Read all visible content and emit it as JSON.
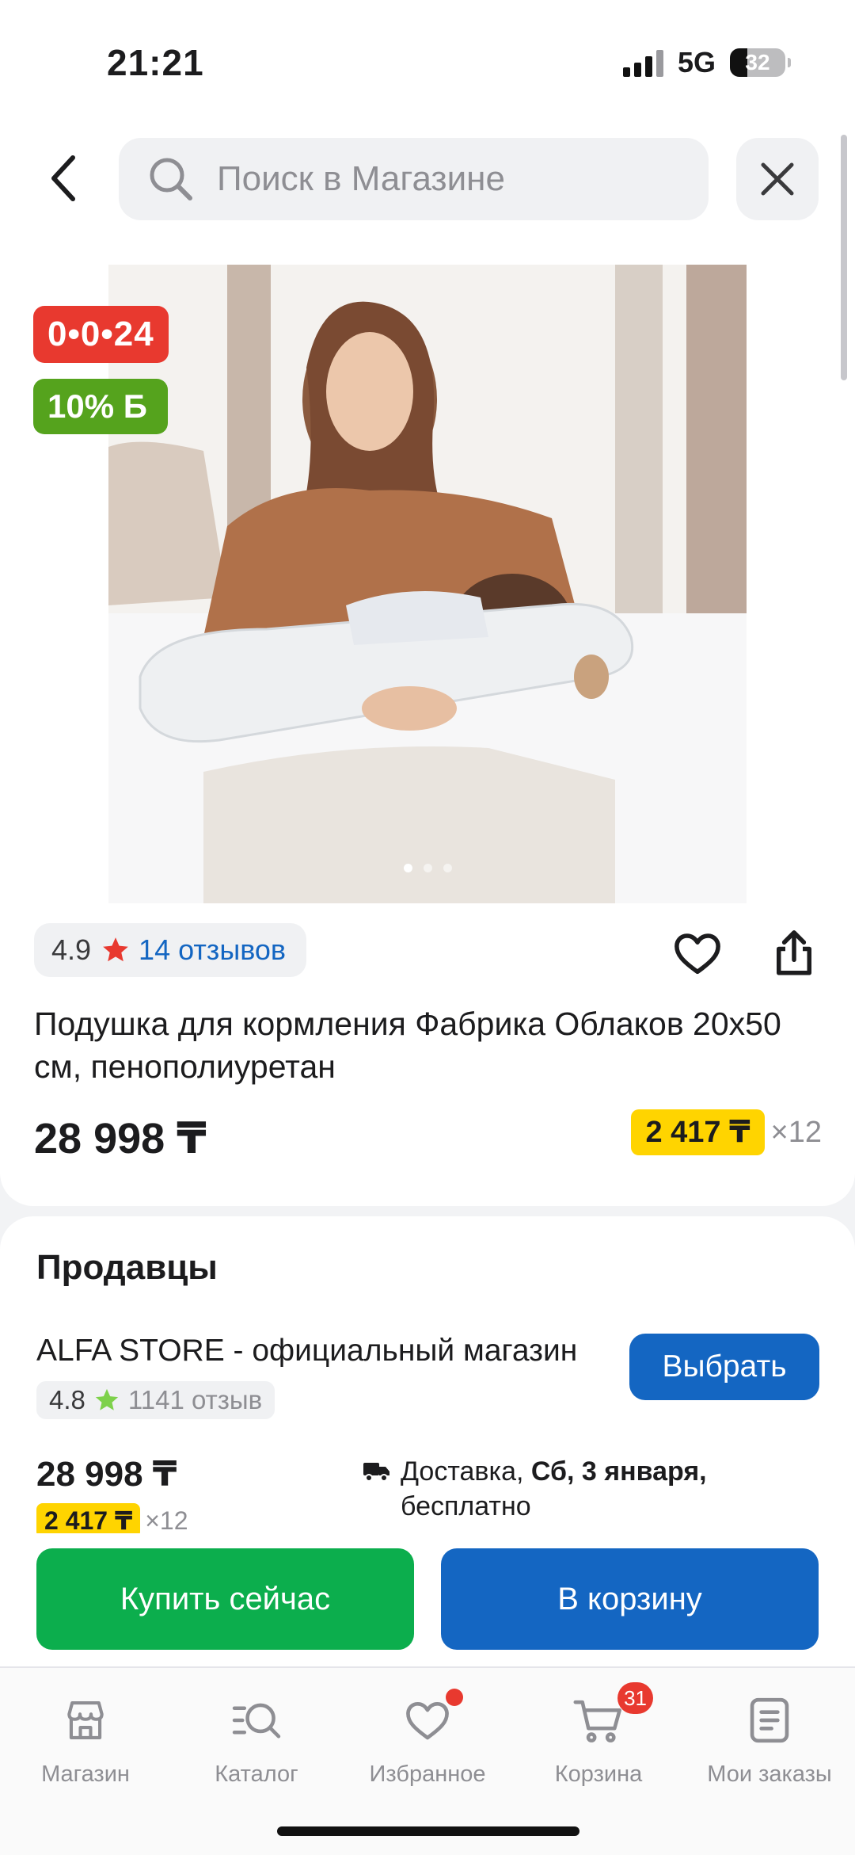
{
  "status_bar": {
    "time": "21:21",
    "network": "5G",
    "battery": "32",
    "battery_level": 0.32
  },
  "search": {
    "placeholder": "Поиск в Магазине",
    "value": ""
  },
  "product": {
    "badge_timer": "0•0•24",
    "badge_bonus": "10% Б",
    "image_slides": 3,
    "active_slide": 1,
    "rating": "4.9",
    "reviews": "14 отзывов",
    "title": "Подушка для кормления Фабрика Облаков 20x50 см, пенополиуретан",
    "price": "28 998 ₸",
    "installment_amount": "2 417 ₸",
    "installment_multiplier": "×12"
  },
  "sellers": {
    "title": "Продавцы",
    "items": [
      {
        "name": "ALFA STORE - официальный магазин",
        "rating": "4.8",
        "reviews": "1141 отзыв",
        "select_label": "Выбрать",
        "price": "28 998 ₸",
        "installment_amount": "2 417 ₸",
        "installment_multiplier": "×12",
        "delivery_prefix": "Доставка,",
        "delivery_date": "Сб, 3 января,",
        "delivery_cost": "бесплатно"
      }
    ]
  },
  "actions": {
    "buy_now": "Купить сейчас",
    "add_to_cart": "В корзину"
  },
  "nav": {
    "items": [
      {
        "label": "Магазин",
        "icon": "shop-icon"
      },
      {
        "label": "Каталог",
        "icon": "catalog-icon"
      },
      {
        "label": "Избранное",
        "icon": "heart-icon"
      },
      {
        "label": "Корзина",
        "icon": "cart-icon",
        "badge": "31"
      },
      {
        "label": "Мои заказы",
        "icon": "orders-icon"
      }
    ]
  },
  "colors": {
    "accent_blue": "#1466c2",
    "buy_green": "#0cae4d",
    "timer_red": "#e8392f",
    "bonus_green": "#55a31d",
    "installment_yellow": "#ffd400"
  }
}
